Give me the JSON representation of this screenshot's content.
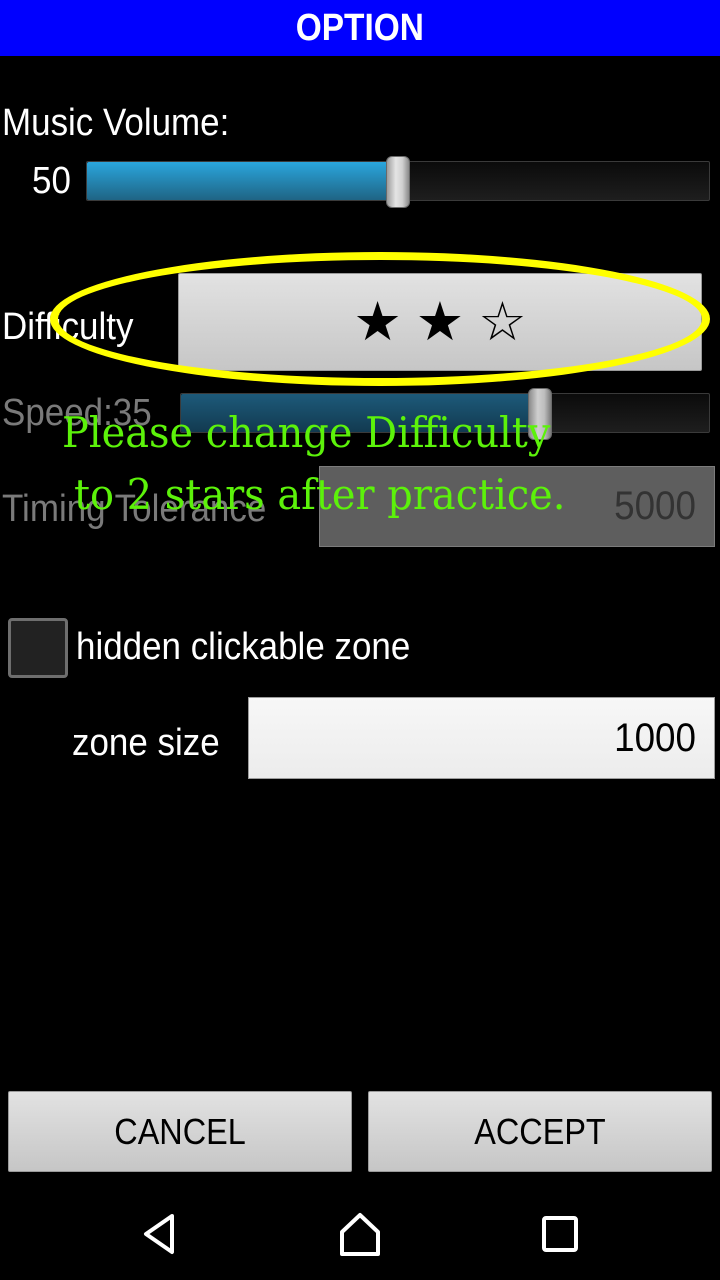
{
  "header": {
    "title": "OPTION",
    "color": "#0000ff"
  },
  "music_volume": {
    "label": "Music Volume:",
    "value_text": "50",
    "value_fraction": 0.5
  },
  "difficulty": {
    "label": "Difficulty",
    "stars": [
      "★",
      "★",
      "☆"
    ],
    "rating": 2,
    "max": 3
  },
  "speed": {
    "label": "Speed:35",
    "value_fraction": 0.68,
    "enabled": false
  },
  "timing_tolerance": {
    "label": "Timing Tolerance",
    "value": "5000",
    "enabled": false
  },
  "hidden_zone": {
    "label": "hidden clickable zone",
    "checked": false
  },
  "zone_size": {
    "label": "zone size",
    "value": "1000"
  },
  "buttons": {
    "cancel": "CANCEL",
    "accept": "ACCEPT"
  },
  "annotation": {
    "line1": "Please change Difficulty",
    "line2": "to 2 stars after practice.",
    "text_color": "#5cf20a",
    "highlight_color": "#ffff00"
  },
  "navbar": {
    "back": "back-icon",
    "home": "home-icon",
    "recents": "recents-icon"
  }
}
